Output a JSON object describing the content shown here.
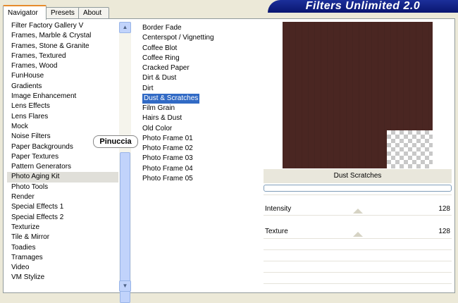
{
  "header": {
    "title": "Filters Unlimited 2.0"
  },
  "tabs": [
    {
      "label": "Navigator",
      "active": true
    },
    {
      "label": "Presets",
      "active": false
    },
    {
      "label": "About",
      "active": false
    }
  ],
  "categories": [
    "Filter Factory Gallery V",
    "Frames, Marble & Crystal",
    "Frames, Stone & Granite",
    "Frames, Textured",
    "Frames, Wood",
    "FunHouse",
    "Gradients",
    "Image Enhancement",
    "Lens Effects",
    "Lens Flares",
    "Mock",
    "Noise Filters",
    "Paper Backgrounds",
    "Paper Textures",
    "Pattern Generators",
    "Photo Aging Kit",
    "Photo Tools",
    "Render",
    "Special Effects 1",
    "Special Effects 2",
    "Texturize",
    "Tile & Mirror",
    "Toadies",
    "Tramages",
    "Video",
    "VM Stylize"
  ],
  "selected_category": "Photo Aging Kit",
  "badge": {
    "text": "Pinuccia"
  },
  "filters": [
    "Border Fade",
    "Centerspot / Vignetting",
    "Coffee Blot",
    "Coffee Ring",
    "Cracked Paper",
    "Dirt & Dust",
    "Dirt",
    "Dust & Scratches",
    "Film Grain",
    "Hairs & Dust",
    "Old Color",
    "Photo Frame 01",
    "Photo Frame 02",
    "Photo Frame 03",
    "Photo Frame 04",
    "Photo Frame 05"
  ],
  "selected_filter": "Dust & Scratches",
  "preview": {
    "filter_name": "Dust  Scratches",
    "color": "#4a2622"
  },
  "params": [
    {
      "label": "Intensity",
      "value": "128"
    },
    {
      "label": "Texture",
      "value": "128"
    }
  ],
  "colors": {
    "selection": "#316ac5",
    "header_bg": "#0a1670",
    "tab_accent": "#e68b2c"
  }
}
